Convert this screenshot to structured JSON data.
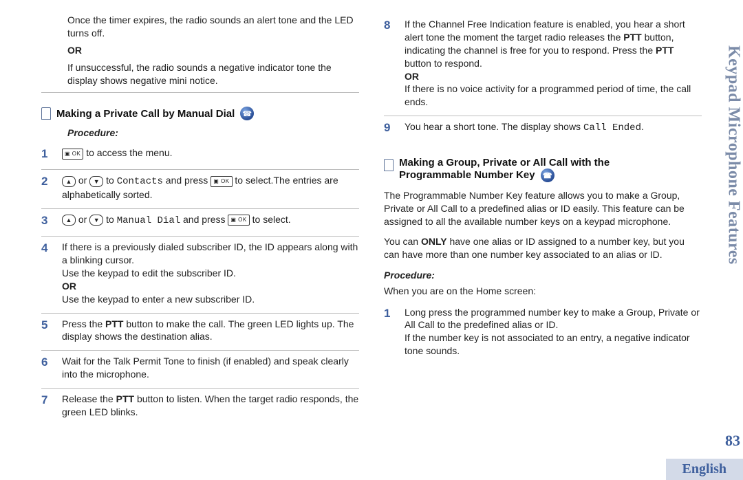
{
  "sideTab": "Keypad Microphone Features",
  "pageNumber": "83",
  "language": "English",
  "left": {
    "introA": "Once the timer expires, the radio sounds an alert tone and the LED turns off.",
    "orA": "OR",
    "introB": "If unsuccessful, the radio sounds a negative indicator tone the display shows negative mini notice.",
    "heading": "Making a Private Call by Manual Dial",
    "procedureLabel": "Procedure:",
    "step1_suffix": " to access the menu.",
    "step2_or": " or ",
    "step2_to": " to ",
    "step2_contacts": "Contacts",
    "step2_andpress": " and press ",
    "step2_select": " to select.The entries are alphabetically sorted.",
    "step3_or": " or ",
    "step3_to": " to ",
    "step3_manualdial": "Manual Dial",
    "step3_andpress": " and press ",
    "step3_select": " to select.",
    "step4a": "If there is a previously dialed subscriber ID, the ID appears along with a blinking cursor.",
    "step4b": "Use the keypad to edit the subscriber ID.",
    "step4or": "OR",
    "step4c": "Use the keypad to enter a new subscriber ID.",
    "step5a": "Press the ",
    "step5b": "PTT",
    "step5c": " button to make the call. The green LED lights up. The display shows the destination alias.",
    "step6": "Wait for the Talk Permit Tone to finish (if enabled) and speak clearly into the microphone.",
    "step7a": "Release the ",
    "step7b": "PTT",
    "step7c": " button to listen. When the target radio responds, the green LED blinks."
  },
  "right": {
    "step8a": "If the Channel Free Indication feature is enabled, you hear a short alert tone the moment the target radio releases the ",
    "step8b": "PTT",
    "step8c": " button, indicating the channel is free for you to respond. Press the ",
    "step8d": "PTT",
    "step8e": " button to respond.",
    "step8or": "OR",
    "step8f": "If there is no voice activity for a programmed period of time, the call ends.",
    "step9a": "You hear a short tone. The display shows ",
    "step9b": "Call Ended",
    "step9c": ".",
    "heading": "Making a Group, Private or All Call with the Programmable Number Key",
    "para1": "The Programmable Number Key feature allows you to make a Group, Private or All Call to a predefined alias or ID easily. This feature can be assigned to all the available number keys on a keypad microphone.",
    "para2a": "You can ",
    "para2b": "ONLY",
    "para2c": " have one alias or ID assigned to a number key, but you can have more than one number key associated to an alias or ID.",
    "procedureLabel": "Procedure:",
    "procNote": "When you are on the Home screen:",
    "pstep1a": "Long press the programmed number key to make a Group, Private or All Call to the predefined alias or ID.",
    "pstep1b": "If the number key is not associated to an entry, a negative indicator tone sounds."
  }
}
